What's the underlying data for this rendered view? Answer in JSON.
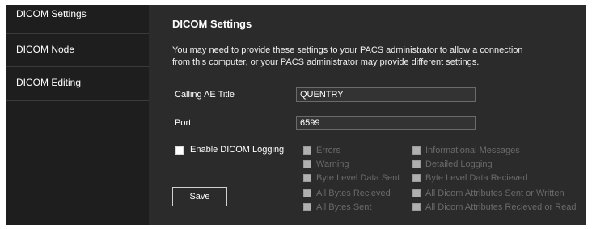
{
  "sidebar": {
    "items": [
      {
        "label": "DICOM Settings"
      },
      {
        "label": "DICOM Node"
      },
      {
        "label": "DICOM Editing"
      }
    ]
  },
  "main": {
    "title": "DICOM Settings",
    "description_line1": "You may need to provide these settings to your PACS administrator to allow a connection",
    "description_line2": "from this computer, or your PACS administrator may provide different settings.",
    "calling_ae_title": {
      "label": "Calling AE Title",
      "value": "QUENTRY"
    },
    "port": {
      "label": "Port",
      "value": "6599"
    },
    "enable_logging": {
      "label": "Enable DICOM Logging",
      "checked": false
    },
    "logging_options_left": [
      {
        "label": "Errors"
      },
      {
        "label": "Warning"
      },
      {
        "label": "Byte Level Data Sent"
      },
      {
        "label": "All Bytes Recieved"
      },
      {
        "label": "All Bytes Sent"
      }
    ],
    "logging_options_right": [
      {
        "label": "Informational Messages"
      },
      {
        "label": "Detailed Logging"
      },
      {
        "label": "Byte Level Data Recieved"
      },
      {
        "label": "All Dicom Attributes Sent or Written"
      },
      {
        "label": "All Dicom Attributes Recieved or Read"
      }
    ],
    "save_label": "Save"
  },
  "colors": {
    "sidebar_bg": "#1e1e1e",
    "main_bg": "#2b2b2b",
    "disabled_text": "#6a6a6a"
  }
}
